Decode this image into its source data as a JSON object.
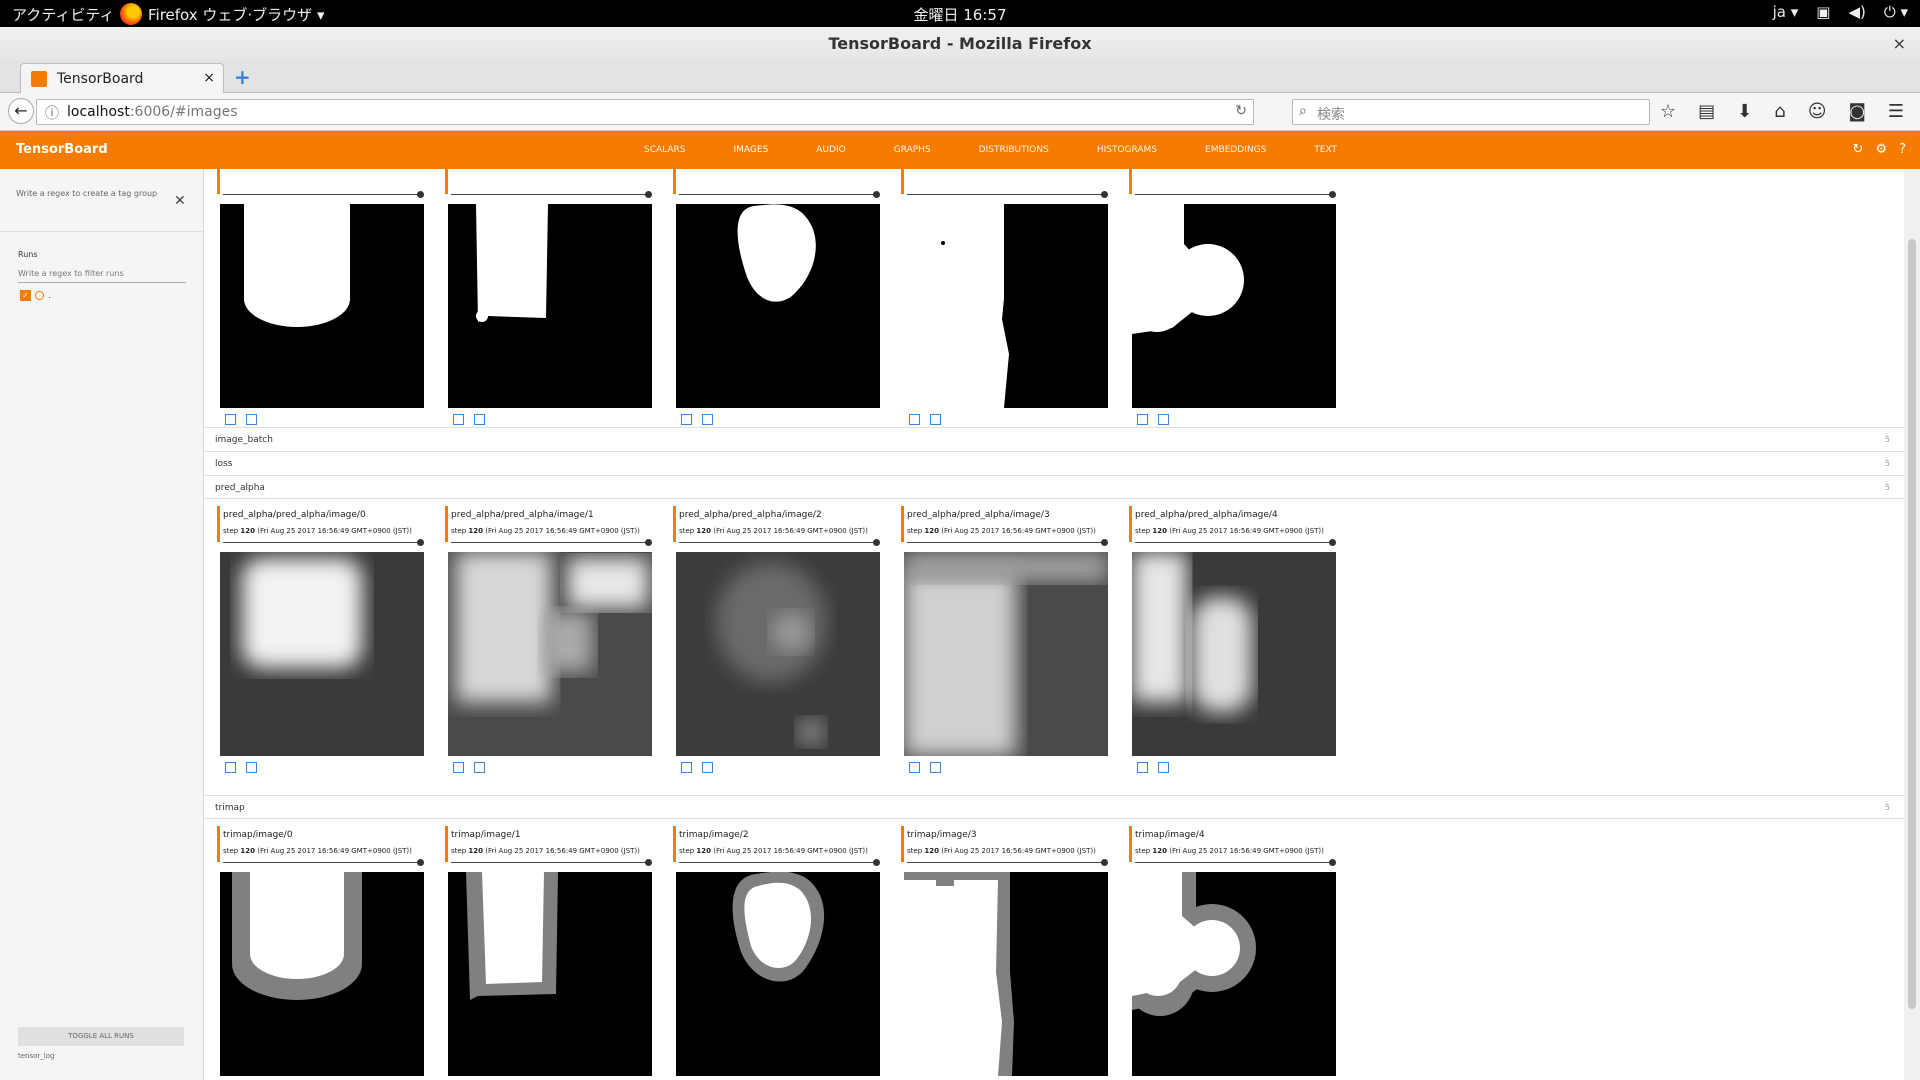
{
  "gnome": {
    "activities": "アクティビティ",
    "app_menu": "Firefox ウェブ·ブラウザ ▾",
    "clock": "金曜日 16:57",
    "lang": "ja ▾"
  },
  "window": {
    "title": "TensorBoard - Mozilla Firefox",
    "close": "×"
  },
  "browser": {
    "tab_title": "TensorBoard",
    "tab_close": "×",
    "new_tab": "+",
    "url_host": "localhost",
    "url_path": ":6006/#images",
    "search_placeholder": "検索"
  },
  "tensorboard": {
    "brand": "TensorBoard",
    "tabs": [
      "SCALARS",
      "IMAGES",
      "AUDIO",
      "GRAPHS",
      "DISTRIBUTIONS",
      "HISTOGRAMS",
      "EMBEDDINGS",
      "TEXT"
    ],
    "active_tab": "IMAGES"
  },
  "sidebar": {
    "tag_group_hint": "Write a regex to create a tag group",
    "runs_title": "Runs",
    "runs_filter_placeholder": "Write a regex to filter runs",
    "run_name": ".",
    "toggle_all": "TOGGLE ALL RUNS",
    "logdir": "tensor_log"
  },
  "groups": {
    "image_batch": {
      "name": "image_batch",
      "count": "5"
    },
    "loss": {
      "name": "loss",
      "count": "5"
    },
    "pred_alpha": {
      "name": "pred_alpha",
      "count": "5"
    },
    "trimap": {
      "name": "trimap",
      "count": "5"
    }
  },
  "cards_pred": [
    {
      "tag": "pred_alpha/pred_alpha/image/0",
      "step_num": "120",
      "step_date": "(Fri Aug 25 2017 16:56:49 GMT+0900 (JST))"
    },
    {
      "tag": "pred_alpha/pred_alpha/image/1",
      "step_num": "120",
      "step_date": "(Fri Aug 25 2017 16:56:49 GMT+0900 (JST))"
    },
    {
      "tag": "pred_alpha/pred_alpha/image/2",
      "step_num": "120",
      "step_date": "(Fri Aug 25 2017 16:56:49 GMT+0900 (JST))"
    },
    {
      "tag": "pred_alpha/pred_alpha/image/3",
      "step_num": "120",
      "step_date": "(Fri Aug 25 2017 16:56:49 GMT+0900 (JST))"
    },
    {
      "tag": "pred_alpha/pred_alpha/image/4",
      "step_num": "120",
      "step_date": "(Fri Aug 25 2017 16:56:49 GMT+0900 (JST))"
    }
  ],
  "cards_trimap": [
    {
      "tag": "trimap/image/0",
      "step_num": "120",
      "step_date": "(Fri Aug 25 2017 16:56:49 GMT+0900 (JST))"
    },
    {
      "tag": "trimap/image/1",
      "step_num": "120",
      "step_date": "(Fri Aug 25 2017 16:56:49 GMT+0900 (JST))"
    },
    {
      "tag": "trimap/image/2",
      "step_num": "120",
      "step_date": "(Fri Aug 25 2017 16:56:49 GMT+0900 (JST))"
    },
    {
      "tag": "trimap/image/3",
      "step_num": "120",
      "step_date": "(Fri Aug 25 2017 16:56:49 GMT+0900 (JST))"
    },
    {
      "tag": "trimap/image/4",
      "step_num": "120",
      "step_date": "(Fri Aug 25 2017 16:56:49 GMT+0900 (JST))"
    }
  ],
  "colors": {
    "accent": "#f57c00",
    "link_blue": "#3a87d8"
  }
}
